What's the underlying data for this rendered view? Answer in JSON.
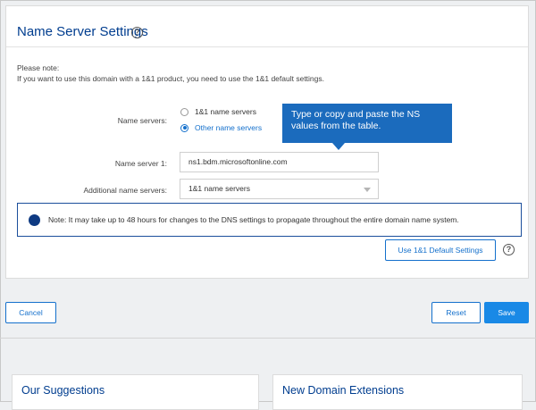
{
  "settings": {
    "title": "Name Server Settings",
    "help_symbol": "?",
    "note_heading": "Please note:",
    "note_text": "If you want to use this domain with a 1&1 product, you need to use the 1&1 default settings.",
    "name_servers_label": "Name servers:",
    "radio_options": [
      "1&1 name servers",
      "Other name servers"
    ],
    "selected_option": "Other name servers",
    "name_server_1_label": "Name server 1:",
    "name_server_1_value": "ns1.bdm.microsoftonline.com",
    "additional_label": "Additional name servers:",
    "additional_value": "1&1 name servers",
    "callout": "Type or copy and paste the NS values from the table.",
    "alert_text": "Note: It may take up to 48 hours for changes to the DNS settings to propagate throughout the entire domain name system.",
    "default_settings_button": "Use 1&1 Default Settings"
  },
  "actions": {
    "cancel": "Cancel",
    "reset": "Reset",
    "save": "Save"
  },
  "panels": {
    "suggestions_title": "Our Suggestions",
    "extensions_title": "New Domain Extensions"
  },
  "colors": {
    "title_blue": "#003d8f",
    "link_blue": "#1470cc",
    "callout_blue": "#1b6bbd",
    "primary_button": "#1989e6"
  }
}
